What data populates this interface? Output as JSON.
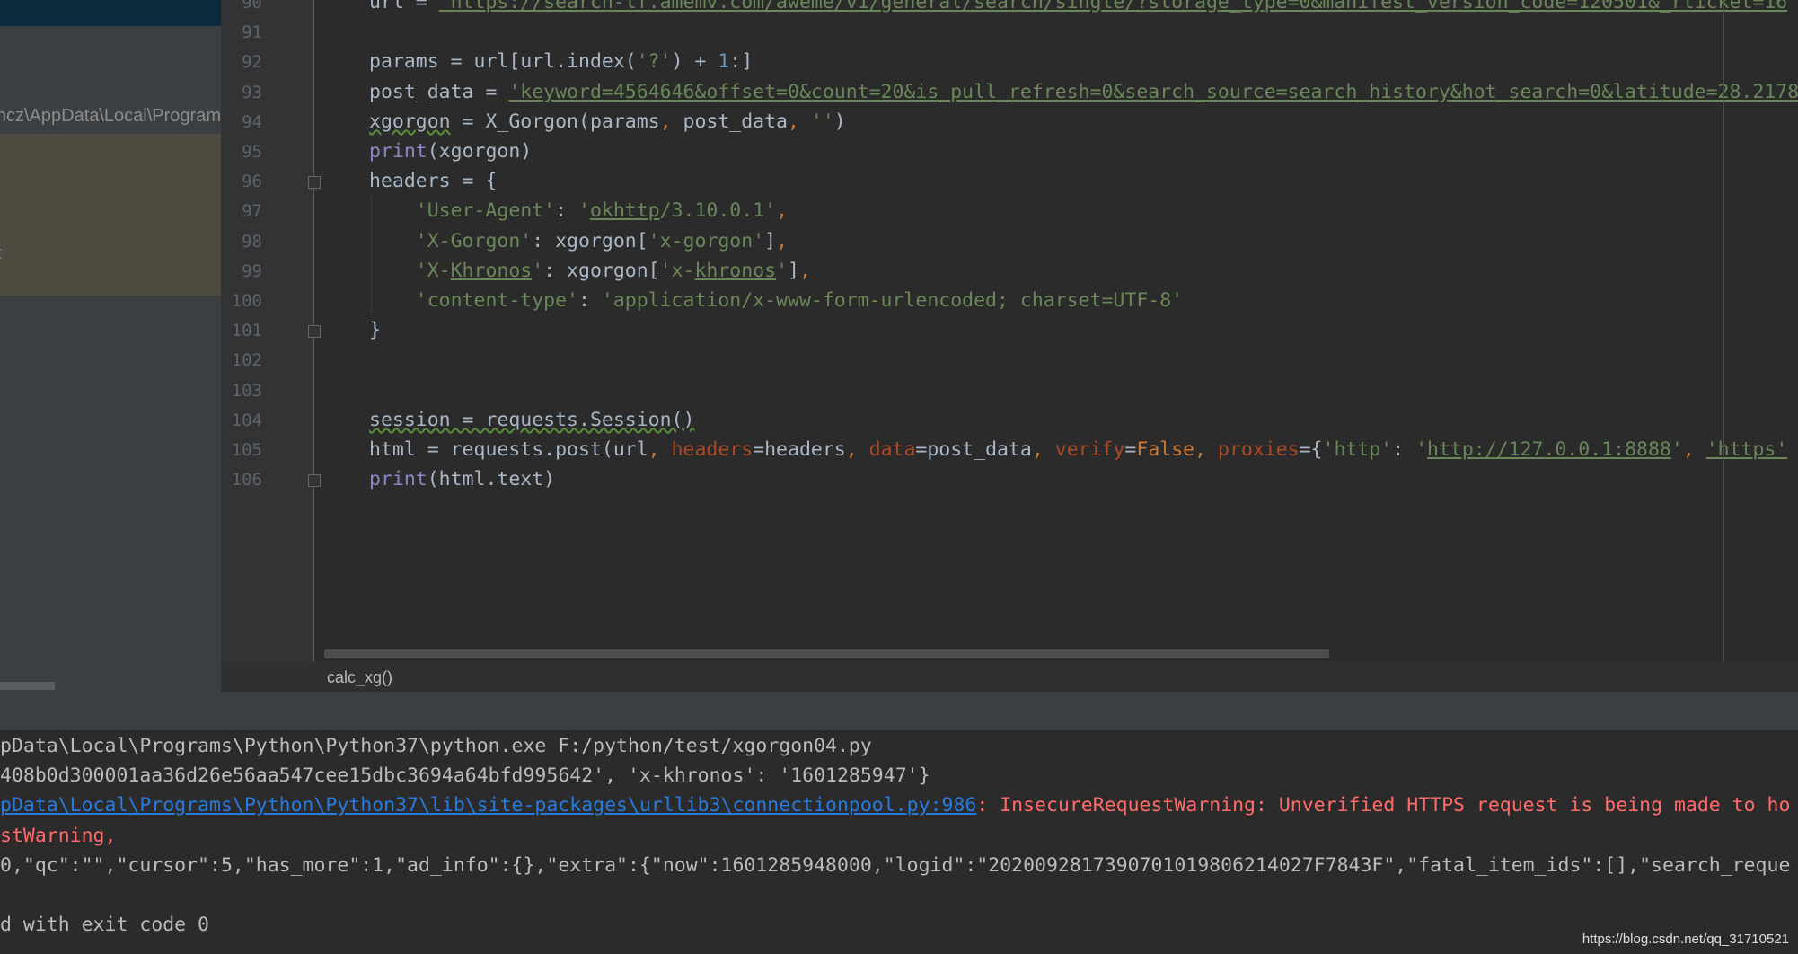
{
  "sidebar": {
    "path_text": "hcz\\AppData\\Local\\Program",
    "highlight_text": "t"
  },
  "editor": {
    "line_numbers": [
      "90",
      "91",
      "92",
      "93",
      "94",
      "95",
      "96",
      "97",
      "98",
      "99",
      "100",
      "101",
      "102",
      "103",
      "104",
      "105",
      "106"
    ],
    "lines": [
      [
        [
          "url = ",
          "df"
        ],
        [
          "'https://search-lf.amemv.com/aweme/v1/general/search/single/?storage_type=0&manifest_version_code=120501&_rticket=16",
          "str u"
        ]
      ],
      [],
      [
        [
          "params = url[url.index(",
          "df"
        ],
        [
          "'?'",
          "str"
        ],
        [
          ") + ",
          "df"
        ],
        [
          "1",
          "num"
        ],
        [
          ":]",
          "df"
        ]
      ],
      [
        [
          "post_data = ",
          "df"
        ],
        [
          "'keyword=4564646&offset=0&count=20&is_pull_refresh=0&search_source=search_history&hot_search=0&latitude=28.2178",
          "str u"
        ]
      ],
      [
        [
          "xgorgon",
          "df w"
        ],
        [
          " = X_Gorgon(params",
          "df"
        ],
        [
          ", ",
          "kw"
        ],
        [
          "post_data",
          "df"
        ],
        [
          ", ",
          "kw"
        ],
        [
          "''",
          "str"
        ],
        [
          ")",
          "df"
        ]
      ],
      [
        [
          "print",
          "bi"
        ],
        [
          "(xgorgon)",
          "df"
        ]
      ],
      [
        [
          "headers = {",
          "df"
        ]
      ],
      [
        [
          "    'User-Agent'",
          "str"
        ],
        [
          ": ",
          "df"
        ],
        [
          "'",
          "str"
        ],
        [
          "okhttp",
          "str u"
        ],
        [
          "/3.10.0.1'",
          "str"
        ],
        [
          ",",
          "kw"
        ]
      ],
      [
        [
          "    'X-Gorgon'",
          "str"
        ],
        [
          ": xgorgon[",
          "df"
        ],
        [
          "'x-gorgon'",
          "str"
        ],
        [
          "]",
          "df"
        ],
        [
          ",",
          "kw"
        ]
      ],
      [
        [
          "    'X-",
          "str"
        ],
        [
          "Khronos",
          "str u"
        ],
        [
          "'",
          "str"
        ],
        [
          ": xgorgon[",
          "df"
        ],
        [
          "'x-",
          "str"
        ],
        [
          "khronos",
          "str u"
        ],
        [
          "'",
          "str"
        ],
        [
          "]",
          "df"
        ],
        [
          ",",
          "kw"
        ]
      ],
      [
        [
          "    'content-type'",
          "str"
        ],
        [
          ": ",
          "df"
        ],
        [
          "'application/x-www-form-urlencoded; charset=UTF-8'",
          "str"
        ]
      ],
      [
        [
          "}",
          "df"
        ]
      ],
      [],
      [],
      [
        [
          "session = requests.Session()",
          "df w"
        ]
      ],
      [
        [
          "html = requests.post(url",
          "df"
        ],
        [
          ", ",
          "kw"
        ],
        [
          "headers",
          "prm"
        ],
        [
          "=headers",
          "df"
        ],
        [
          ", ",
          "kw"
        ],
        [
          "data",
          "prm"
        ],
        [
          "=post_data",
          "df"
        ],
        [
          ", ",
          "kw"
        ],
        [
          "verify",
          "prm"
        ],
        [
          "=",
          "df"
        ],
        [
          "False",
          "kw"
        ],
        [
          ", ",
          "kw"
        ],
        [
          "proxies",
          "prm"
        ],
        [
          "={",
          "df"
        ],
        [
          "'http'",
          "str"
        ],
        [
          ": ",
          "df"
        ],
        [
          "'",
          "str"
        ],
        [
          "http://127.0.0.1:8888",
          "str u"
        ],
        [
          "'",
          "str"
        ],
        [
          ", ",
          "kw"
        ],
        [
          "'https'",
          "str u"
        ]
      ],
      [
        [
          "print",
          "bi"
        ],
        [
          "(html.text)",
          "df"
        ]
      ]
    ],
    "breadcrumb": "calc_xg()"
  },
  "console": {
    "lines": [
      [
        [
          "pData\\Local\\Programs\\Python\\Python37\\python.exe F:/python/test/xgorgon04.py",
          ""
        ]
      ],
      [
        [
          "408b0d300001aa36d26e56aa547cee15dbc3694a64bfd995642', 'x-khronos': '1601285947'}",
          ""
        ]
      ],
      [
        [
          "pData\\Local\\Programs\\Python\\Python37\\lib\\site-packages\\urllib3\\connectionpool.py:986",
          "link"
        ],
        [
          ": InsecureRequestWarning: Unverified HTTPS request is being made to ho",
          "err"
        ]
      ],
      [
        [
          "stWarning,",
          "err"
        ]
      ],
      [
        [
          "0,\"qc\":\"\",\"cursor\":5,\"has_more\":1,\"ad_info\":{},\"extra\":{\"now\":1601285948000,\"logid\":\"2020092817390701019806214027F7843F\",\"fatal_item_ids\":[],\"search_reque",
          ""
        ]
      ],
      [],
      [
        [
          "d with exit code 0",
          ""
        ]
      ]
    ]
  },
  "watermark": "https://blog.csdn.net/qq_31710521",
  "colors": {
    "background": "#2b2b2b",
    "string": "#6a8759",
    "keyword": "#cc7832",
    "error": "#ff6b68",
    "link": "#287bde"
  }
}
